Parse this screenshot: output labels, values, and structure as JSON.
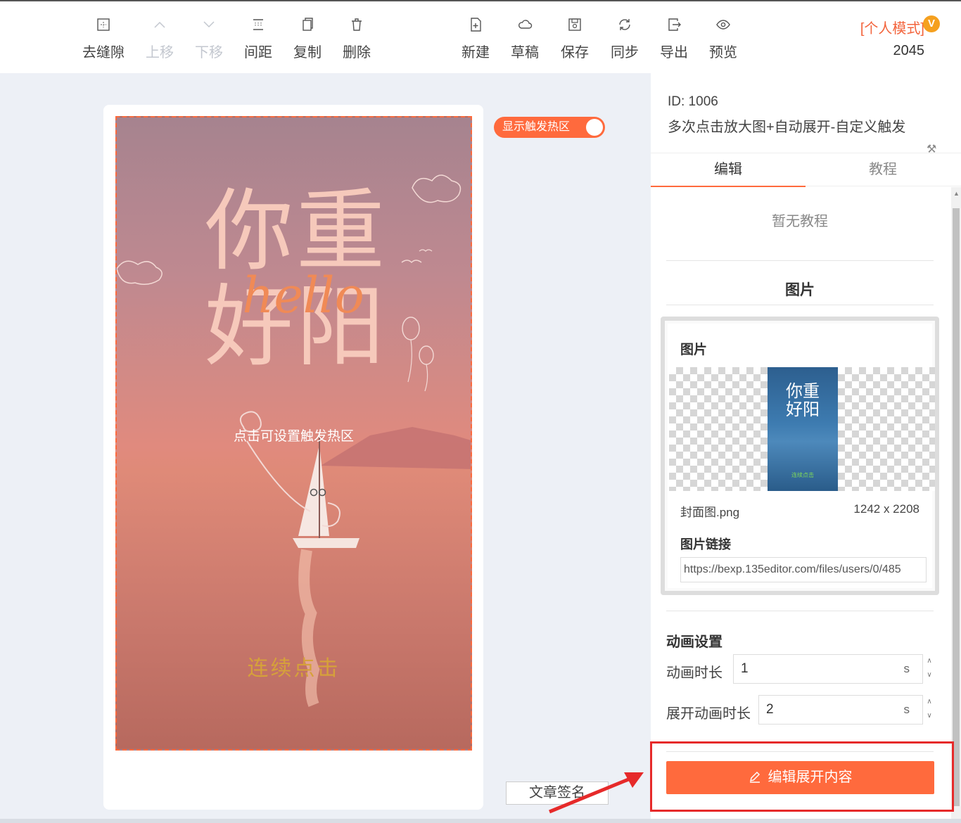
{
  "toolbar": {
    "left_tools": [
      {
        "label": "去缝隙",
        "icon": "remove-gap-icon"
      },
      {
        "label": "上移",
        "icon": "arrow-up-icon"
      },
      {
        "label": "下移",
        "icon": "arrow-down-icon"
      },
      {
        "label": "间距",
        "icon": "spacing-icon"
      },
      {
        "label": "复制",
        "icon": "copy-icon"
      },
      {
        "label": "删除",
        "icon": "trash-icon"
      }
    ],
    "right_tools": [
      {
        "label": "新建",
        "icon": "new-file-icon"
      },
      {
        "label": "草稿",
        "icon": "cloud-icon"
      },
      {
        "label": "保存",
        "icon": "save-icon"
      },
      {
        "label": "同步",
        "icon": "sync-icon"
      },
      {
        "label": "导出",
        "icon": "export-icon"
      },
      {
        "label": "预览",
        "icon": "eye-icon"
      }
    ],
    "mode_label": "[个人模式]",
    "mode_badge": "V",
    "mode_count": "2045"
  },
  "canvas": {
    "poster_title": "你重好阳",
    "poster_script": "hello",
    "hotzone_text": "点击可设置触发热区",
    "cta_text": "连续点击",
    "toggle_label": "显示触发热区",
    "sign_button": "文章签名"
  },
  "panel": {
    "id": "ID: 1006",
    "name": "多次点击放大图+自动展开-自定义触发",
    "tabs": [
      "编辑",
      "教程"
    ],
    "no_tutorial": "暂无教程",
    "image_section_title": "图片",
    "image_label": "图片",
    "thumb_title": "你重好阳",
    "thumb_caption": "连续点击",
    "file_name": "封面图.png",
    "file_size": "1242 x 2208",
    "link_label": "图片链接",
    "link_value": "https://bexp.135editor.com/files/users/0/485",
    "animation_title": "动画设置",
    "duration_label": "动画时长",
    "duration_value": "1",
    "expand_label": "展开动画时长",
    "expand_value": "2",
    "unit": "s",
    "edit_button": "编辑展开内容"
  },
  "colors": {
    "accent": "#ff6a3d",
    "highlight_border": "#e62a2a",
    "page_bg": "#edf0f6"
  }
}
